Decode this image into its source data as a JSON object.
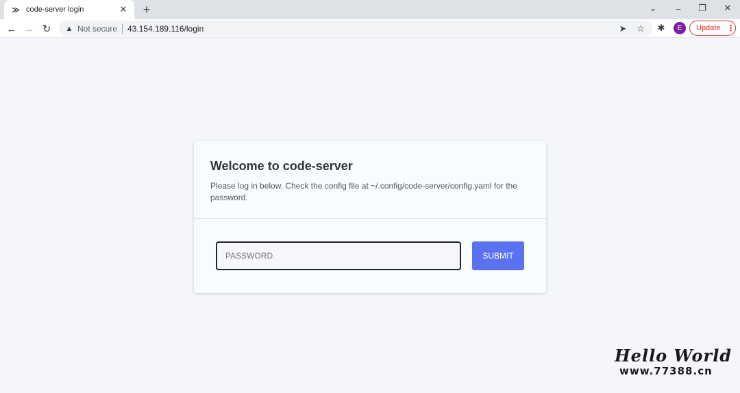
{
  "tab": {
    "favicon": "≫",
    "title": "code-server login",
    "close_icon": "✕"
  },
  "new_tab_icon": "+",
  "window_controls": {
    "dropdown": "⌄",
    "minimize": "–",
    "restore": "❐",
    "close": "✕"
  },
  "toolbar": {
    "back_icon": "←",
    "forward_icon": "→",
    "reload_icon": "↻",
    "warning_icon": "▲",
    "security_label": "Not secure",
    "url": "43.154.189.116/login",
    "send_icon": "➤",
    "star_icon": "☆",
    "extensions_icon": "✱",
    "avatar_letter": "E",
    "update_label": "Update",
    "menu_icon": "⋮"
  },
  "login": {
    "title": "Welcome to code-server",
    "description": "Please log in below. Check the config file at ~/.config/code-server/config.yaml for the password.",
    "password_placeholder": "PASSWORD",
    "submit_label": "SUBMIT"
  },
  "watermark": {
    "title": "Hello World",
    "url": "www.77388.cn"
  },
  "colors": {
    "accent": "#5a72f0",
    "page_background": "#f4f6fb",
    "update_red": "#d93025",
    "avatar_purple": "#7b1fa2"
  }
}
